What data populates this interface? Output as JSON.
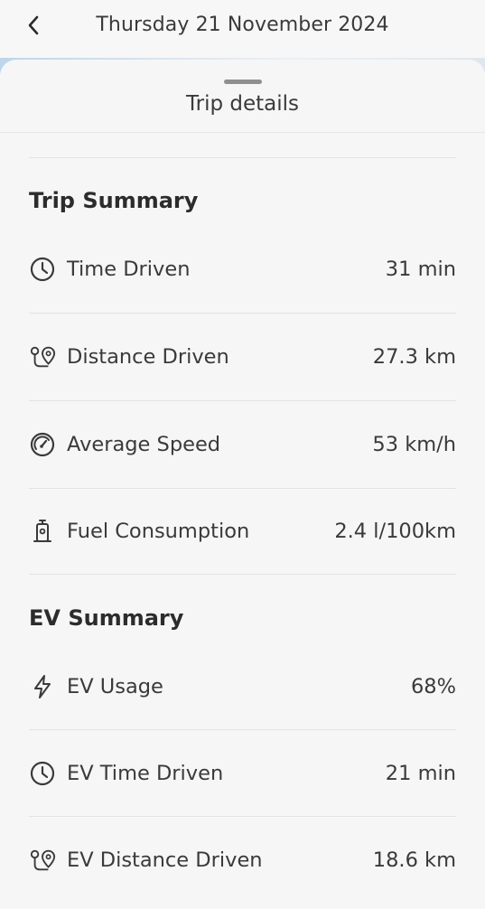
{
  "header": {
    "date": "Thursday 21 November 2024",
    "back_icon": "chevron-left-icon"
  },
  "sheet": {
    "title": "Trip details"
  },
  "trip_summary": {
    "title": "Trip Summary",
    "rows": [
      {
        "icon": "clock-icon",
        "label": "Time Driven",
        "value": "31 min"
      },
      {
        "icon": "route-pin-icon",
        "label": "Distance Driven",
        "value": "27.3 km"
      },
      {
        "icon": "speedometer-icon",
        "label": "Average Speed",
        "value": "53 km/h"
      },
      {
        "icon": "fuel-pump-icon",
        "label": "Fuel Consumption",
        "value": "2.4 l/100km"
      }
    ]
  },
  "ev_summary": {
    "title": "EV Summary",
    "rows": [
      {
        "icon": "lightning-icon",
        "label": "EV Usage",
        "value": "68%"
      },
      {
        "icon": "clock-icon",
        "label": "EV Time Driven",
        "value": "21 min"
      },
      {
        "icon": "route-pin-icon",
        "label": "EV Distance Driven",
        "value": "18.6 km"
      }
    ]
  }
}
